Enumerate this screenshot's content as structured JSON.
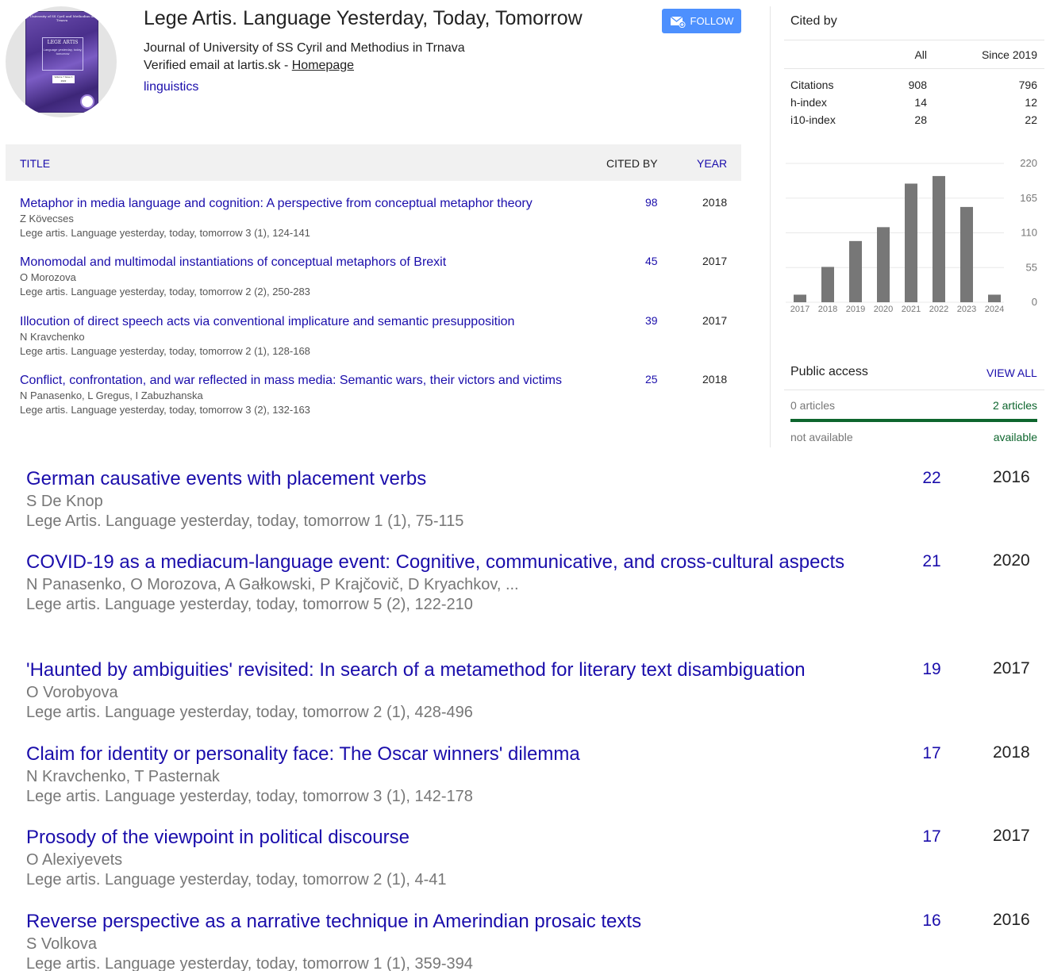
{
  "profile": {
    "cover": {
      "journal_top": "University of SS Cyril and Methodius in Trnava",
      "title": "LEGE ARTIS",
      "subtitle": "Language yesterday, today, tomorrow",
      "label": "Volume 7 Issue 1 2022"
    },
    "name": "Lege Artis. Language Yesterday, Today, Tomorrow",
    "affiliation": "Journal of University of SS Cyril and Methodius in Trnava",
    "email_text": "Verified email at lartis.sk - ",
    "homepage_label": "Homepage",
    "interest": "linguistics",
    "follow_label": "FOLLOW"
  },
  "table": {
    "col_title": "TITLE",
    "col_cited": "CITED BY",
    "col_year": "YEAR"
  },
  "small_rows": [
    {
      "title": "Metaphor in media language and cognition: A perspective from conceptual metaphor theory",
      "authors": "Z Kövecses",
      "venue": "Lege artis. Language yesterday, today, tomorrow 3 (1), 124-141",
      "cited": "98",
      "year": "2018"
    },
    {
      "title": "Monomodal and multimodal instantiations of conceptual metaphors of Brexit",
      "authors": "O Morozova",
      "venue": "Lege artis. Language yesterday, today, tomorrow 2 (2), 250-283",
      "cited": "45",
      "year": "2017"
    },
    {
      "title": "Illocution of direct speech acts via conventional implicature and semantic presupposition",
      "authors": "N Kravchenko",
      "venue": "Lege artis. Language yesterday, today, tomorrow 2 (1), 128-168",
      "cited": "39",
      "year": "2017"
    },
    {
      "title": "Conflict, confrontation, and war reflected in mass media: Semantic wars, their victors and victims",
      "authors": "N Panasenko, L Gregus, I Zabuzhanska",
      "venue": "Lege artis. Language yesterday, today, tomorrow 3 (2), 132-163",
      "cited": "25",
      "year": "2018"
    }
  ],
  "big_rows": [
    {
      "title": "German causative events with placement verbs",
      "authors": "S De Knop",
      "venue": "Lege Artis. Language yesterday, today, tomorrow 1 (1), 75-115",
      "cited": "22",
      "year": "2016"
    },
    {
      "title": "COVID-19 as a mediacum-language event: Cognitive, communicative, and cross-cultural aspects",
      "authors": "N Panasenko, O Morozova, A Gałkowski, P Krajčovič, D Kryachkov, ...",
      "venue": "Lege artis. Language yesterday, today, tomorrow 5 (2), 122-210",
      "cited": "21",
      "year": "2020"
    },
    {
      "title": "'Haunted by ambiguities' revisited: In search of a metamethod for literary text disambiguation",
      "authors": "O Vorobyova",
      "venue": "Lege artis. Language yesterday, today, tomorrow 2 (1), 428-496",
      "cited": "19",
      "year": "2017"
    },
    {
      "title": "Claim for identity or personality face: The Oscar winners' dilemma",
      "authors": "N Kravchenko, T Pasternak",
      "venue": "Lege artis. Language yesterday, today, tomorrow 3 (1), 142-178",
      "cited": "17",
      "year": "2018"
    },
    {
      "title": "Prosody of the viewpoint in political discourse",
      "authors": "O Alexiyevets",
      "venue": "Lege artis. Language yesterday, today, tomorrow 2 (1), 4-41",
      "cited": "17",
      "year": "2017"
    },
    {
      "title": "Reverse perspective as a narrative technique in Amerindian prosaic texts",
      "authors": "S Volkova",
      "venue": "Lege artis. Language yesterday, today, tomorrow 1 (1), 359-394",
      "cited": "16",
      "year": "2016"
    }
  ],
  "cited_by": {
    "title": "Cited by",
    "col_all": "All",
    "col_since": "Since 2019",
    "rows": [
      {
        "label": "Citations",
        "all": "908",
        "since": "796"
      },
      {
        "label": "h-index",
        "all": "14",
        "since": "12"
      },
      {
        "label": "i10-index",
        "all": "28",
        "since": "22"
      }
    ]
  },
  "chart_data": {
    "type": "bar",
    "categories": [
      "2017",
      "2018",
      "2019",
      "2020",
      "2021",
      "2022",
      "2023",
      "2024"
    ],
    "values": [
      12,
      56,
      97,
      119,
      188,
      200,
      151,
      12
    ],
    "ylim": [
      0,
      220
    ],
    "yticks": [
      "0",
      "55",
      "110",
      "165",
      "220"
    ],
    "grid": true,
    "bar_color": "#777777"
  },
  "public_access": {
    "title": "Public access",
    "view_all": "VIEW ALL",
    "not_available_count": "0 articles",
    "available_count": "2 articles",
    "not_available_label": "not available",
    "available_label": "available",
    "available_color": "#0d652d"
  }
}
